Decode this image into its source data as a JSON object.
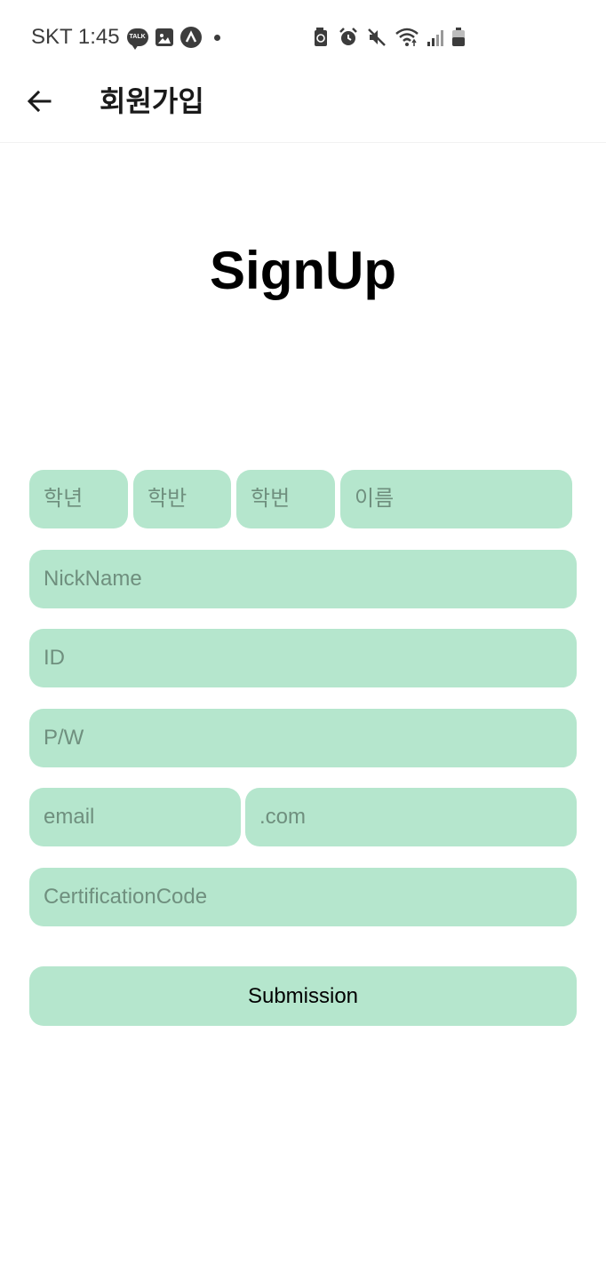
{
  "status_bar": {
    "carrier_time": "SKT 1:45",
    "talk_badge": "TALK"
  },
  "app_bar": {
    "title": "회원가입"
  },
  "heading": "SignUp",
  "form": {
    "grade_placeholder": "학년",
    "class_placeholder": "학반",
    "number_placeholder": "학번",
    "name_placeholder": "이름",
    "nickname_placeholder": "NickName",
    "id_placeholder": "ID",
    "password_placeholder": "P/W",
    "email_placeholder": "email",
    "domain_placeholder": ".com",
    "cert_placeholder": "CertificationCode",
    "submit_label": "Submission"
  },
  "colors": {
    "field_bg": "#b5e6cd",
    "placeholder": "#6f8f7e"
  }
}
